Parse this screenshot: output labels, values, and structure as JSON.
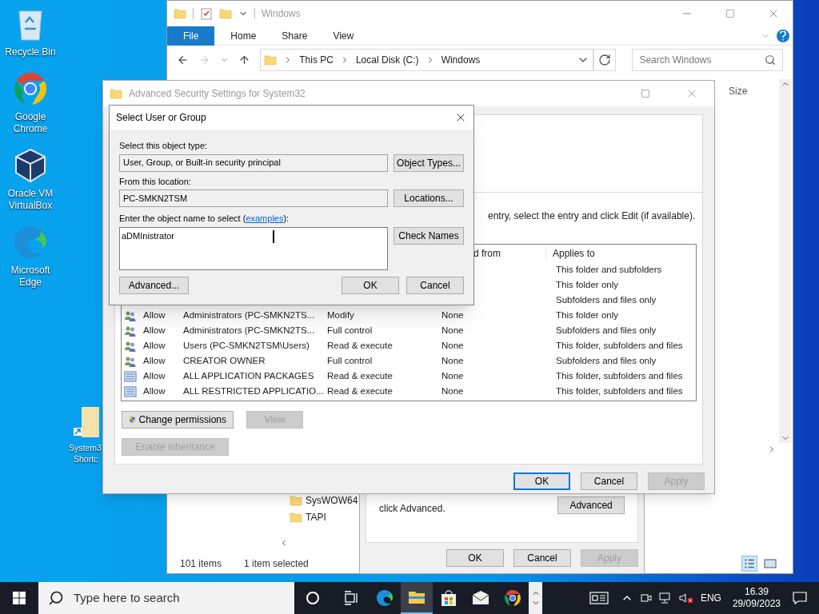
{
  "desktop_icons": [
    {
      "kind": "recycle",
      "label": "Recycle Bin"
    },
    {
      "kind": "chrome",
      "label": "Google Chrome"
    },
    {
      "kind": "virtualbox",
      "label": "Oracle VM VirtualBox"
    },
    {
      "kind": "edge",
      "label": "Microsoft Edge"
    }
  ],
  "shortcut": {
    "label_lines": [
      "System3",
      "Shortc"
    ]
  },
  "explorer": {
    "title": "Windows",
    "ribbon_tabs": [
      {
        "label": "File",
        "selected": true
      },
      {
        "label": "Home",
        "selected": false
      },
      {
        "label": "Share",
        "selected": false
      },
      {
        "label": "View",
        "selected": false
      }
    ],
    "path": [
      "This PC",
      "Local Disk (C:)",
      "Windows"
    ],
    "search_placeholder": "Search Windows",
    "column_header": "Size",
    "items": [
      "SysWOW64",
      "TAPI"
    ],
    "status_count": "101 items",
    "status_selection": "1 item selected"
  },
  "properties": {
    "note": "click Advanced.",
    "advanced_button": "Advanced",
    "buttons": [
      {
        "label": "OK",
        "disabled": false
      },
      {
        "label": "Cancel",
        "disabled": false
      },
      {
        "label": "Apply",
        "disabled": true
      }
    ]
  },
  "advanced": {
    "title": "Advanced Security Settings for System32",
    "instruction": "entry, select the entry and click Edit (if available).",
    "header_inherited": "d from",
    "header_applies": "Applies to",
    "rows": [
      {
        "applies": "This folder and subfolders"
      },
      {
        "applies": "This folder only"
      },
      {
        "applies": "Subfolders and files only"
      },
      {
        "kind": "group",
        "type": "Allow",
        "principal": "Administrators (PC-SMKN2TS...",
        "access": "Modify",
        "inherited": "None",
        "applies": "This folder only"
      },
      {
        "kind": "group",
        "type": "Allow",
        "principal": "Administrators (PC-SMKN2TS...",
        "access": "Full control",
        "inherited": "None",
        "applies": "Subfolders and files only"
      },
      {
        "kind": "group",
        "type": "Allow",
        "principal": "Users (PC-SMKN2TSM\\Users)",
        "access": "Read & execute",
        "inherited": "None",
        "applies": "This folder, subfolders and files"
      },
      {
        "kind": "group",
        "type": "Allow",
        "principal": "CREATOR OWNER",
        "access": "Full control",
        "inherited": "None",
        "applies": "Subfolders and files only"
      },
      {
        "kind": "package",
        "type": "Allow",
        "principal": "ALL APPLICATION PACKAGES",
        "access": "Read & execute",
        "inherited": "None",
        "applies": "This folder, subfolders and files"
      },
      {
        "kind": "package",
        "type": "Allow",
        "principal": "ALL RESTRICTED APPLICATIO...",
        "access": "Read & execute",
        "inherited": "None",
        "applies": "This folder, subfolders and files"
      }
    ],
    "change_permissions": "Change permissions",
    "view": {
      "label": "View",
      "disabled": true
    },
    "enable_inheritance": {
      "label": "Enable inheritance",
      "disabled": true
    },
    "buttons": [
      {
        "label": "OK",
        "disabled": false,
        "default": true
      },
      {
        "label": "Cancel",
        "disabled": false,
        "default": false
      },
      {
        "label": "Apply",
        "disabled": true,
        "default": false
      }
    ]
  },
  "dialog": {
    "title": "Select User or Group",
    "object_type_label": "Select this object type:",
    "object_type": "User, Group, or Built-in security principal",
    "object_types_button": "Object Types...",
    "location_label": "From this location:",
    "location": "PC-SMKN2TSM",
    "locations_button": "Locations...",
    "name_label": "Enter the object name to select (",
    "name_link": "examples",
    "name_label_end": "):",
    "name_value": "aDMInistrator",
    "check_names_button": "Check Names",
    "advanced_button": "Advanced...",
    "ok_button": "OK",
    "cancel_button": "Cancel"
  },
  "taskbar": {
    "search_placeholder": "Type here to search",
    "apps": [
      {
        "kind": "edge",
        "active": false
      },
      {
        "kind": "explorer",
        "active": true
      },
      {
        "kind": "store",
        "active": false
      },
      {
        "kind": "mail",
        "active": false
      },
      {
        "kind": "chrome",
        "active": false
      }
    ],
    "language": "ENG",
    "time": "16.39",
    "date": "29/09/2023"
  }
}
